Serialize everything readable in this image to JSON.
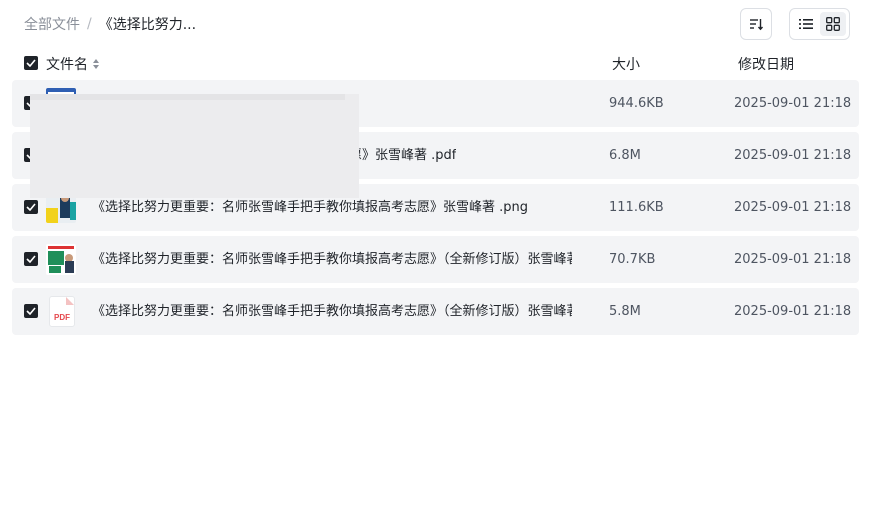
{
  "breadcrumb": {
    "root": "全部文件",
    "separator": "/",
    "current": "《选择比努力..."
  },
  "toolbar": {
    "sort_icon": "sort-desc-icon",
    "views": [
      "list-view-icon",
      "grid-view-icon"
    ]
  },
  "columns": {
    "name": "文件名",
    "size": "大小",
    "date": "修改日期"
  },
  "files": [
    {
      "name": "",
      "size": "944.6KB",
      "date": "2025-09-01 21:18",
      "icon": "image-thumbnail-icon",
      "checked": true
    },
    {
      "name": "高考志愿》张雪峰著 .pdf",
      "size": "6.8M",
      "date": "2025-09-01 21:18",
      "icon": "pdf-file-icon",
      "checked": true
    },
    {
      "name": "《选择比努力更重要：名师张雪峰手把手教你填报高考志愿》张雪峰著 .png",
      "size": "111.6KB",
      "date": "2025-09-01 21:18",
      "icon": "image-thumbnail-icon",
      "checked": true
    },
    {
      "name": "《选择比努力更重要：名师张雪峰手把手教你填报高考志愿》（全新修订版）张雪峰著 .j...",
      "size": "70.7KB",
      "date": "2025-09-01 21:18",
      "icon": "image-thumbnail-icon",
      "checked": true
    },
    {
      "name": "《选择比努力更重要：名师张雪峰手把手教你填报高考志愿》（全新修订版）张雪峰著 ....",
      "size": "5.8M",
      "date": "2025-09-01 21:18",
      "icon": "pdf-file-icon",
      "checked": true
    }
  ],
  "pdf_label": "PDF",
  "colors": {
    "row_bg": "#f3f4f6",
    "checkbox": "#1f2329",
    "pdf_red": "#e5484d"
  }
}
